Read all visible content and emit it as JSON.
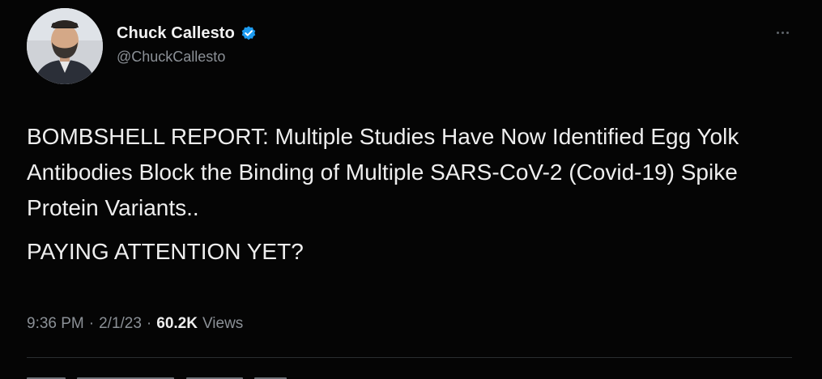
{
  "tweet": {
    "author": {
      "display_name": "Chuck Callesto",
      "handle": "@ChuckCallesto",
      "verified": true,
      "avatar_icon": "profile-photo"
    },
    "more_icon": "ellipsis-icon",
    "text": {
      "paragraph_1": "BOMBSHELL REPORT: Multiple Studies Have Now Identified Egg Yolk Antibodies Block the Binding of Multiple SARS-CoV-2 (Covid-19) Spike Protein Variants..",
      "paragraph_2": "PAYING ATTENTION YET?"
    },
    "meta": {
      "time": "9:36 PM",
      "separator": "·",
      "date": "2/1/23",
      "views_count": "60.2K",
      "views_label": "Views"
    }
  },
  "colors": {
    "background": "#050505",
    "primary_text": "#eeeeee",
    "secondary_text": "#8b9096",
    "verified_badge": "#1d9bf0",
    "divider": "#2a2d30"
  }
}
